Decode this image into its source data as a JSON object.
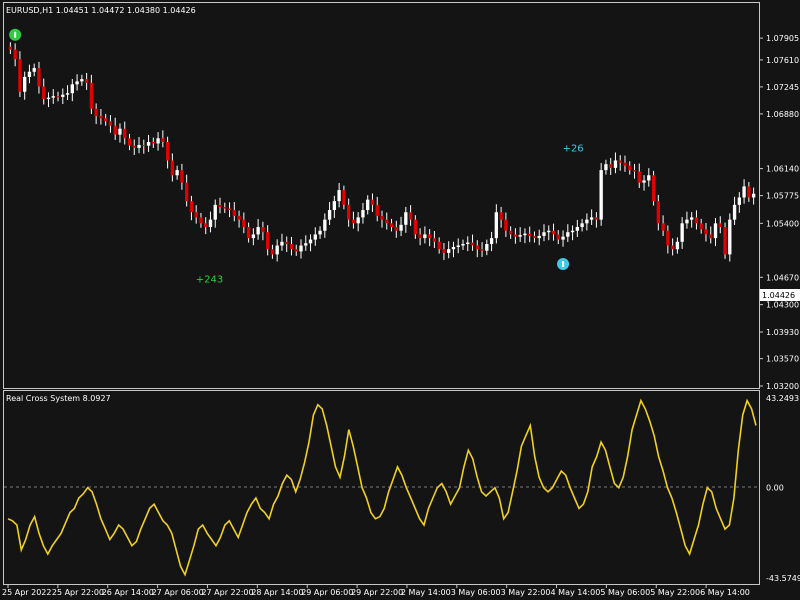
{
  "colors": {
    "background": "#141414",
    "frame": "#c8c8c8",
    "grid_zero": "#7a7a7a",
    "bull": "#ffffff",
    "bear": "#e00000",
    "wick": "#ffffff",
    "indicator": "#f0d020",
    "signal_buy": "#2ecc40",
    "signal_sell": "#40c8e8",
    "price_tag_bg": "#ffffff",
    "price_tag_fg": "#000000"
  },
  "chart_data": [
    {
      "type": "candlestick",
      "title": "EURUSD,H1 1.04451 1.04472 1.04380 1.04426",
      "y_ticks": [
        "1.07905",
        "1.07610",
        "1.07245",
        "1.06880",
        "1.06140",
        "1.05775",
        "1.05400",
        "1.04670",
        "1.04300",
        "1.03930",
        "1.03570",
        "1.03200"
      ],
      "ylim": [
        1.032,
        1.0815
      ],
      "current_price": "1.04426",
      "x_labels": [
        "25 Apr 2022",
        "25 Apr 22:00",
        "26 Apr 14:00",
        "27 Apr 06:00",
        "27 Apr 22:00",
        "28 Apr 14:00",
        "29 Apr 06:00",
        "29 Apr 22:00",
        "2 May 14:00",
        "3 May 06:00",
        "3 May 22:00",
        "4 May 14:00",
        "5 May 06:00",
        "5 May 22:00",
        "6 May 14:00"
      ],
      "close": [
        1.0775,
        1.0762,
        1.0718,
        1.0738,
        1.0745,
        1.075,
        1.0725,
        1.0708,
        1.071,
        1.0712,
        1.0711,
        1.0714,
        1.0716,
        1.0728,
        1.0732,
        1.0735,
        1.073,
        1.0695,
        1.0685,
        1.0682,
        1.0678,
        1.0672,
        1.066,
        1.0668,
        1.0655,
        1.0645,
        1.0642,
        1.0646,
        1.0645,
        1.065,
        1.0648,
        1.0655,
        1.065,
        1.0625,
        1.0605,
        1.0612,
        1.0595,
        1.057,
        1.0555,
        1.0548,
        1.054,
        1.0535,
        1.0545,
        1.0565,
        1.0562,
        1.056,
        1.0558,
        1.055,
        1.0545,
        1.0535,
        1.052,
        1.0525,
        1.0535,
        1.0528,
        1.0505,
        1.0498,
        1.051,
        1.0515,
        1.0512,
        1.0505,
        1.0502,
        1.051,
        1.0513,
        1.0518,
        1.0525,
        1.053,
        1.0545,
        1.0558,
        1.057,
        1.0585,
        1.0565,
        1.0545,
        1.054,
        1.0548,
        1.0558,
        1.0572,
        1.0565,
        1.055,
        1.0545,
        1.054,
        1.0535,
        1.053,
        1.0538,
        1.0555,
        1.0545,
        1.0525,
        1.052,
        1.0525,
        1.052,
        1.0515,
        1.0505,
        1.05,
        1.0505,
        1.0508,
        1.051,
        1.0512,
        1.0514,
        1.051,
        1.0505,
        1.0503,
        1.0512,
        1.052,
        1.0555,
        1.0545,
        1.053,
        1.0525,
        1.0522,
        1.0524,
        1.0526,
        1.0523,
        1.052,
        1.0523,
        1.0528,
        1.053,
        1.0525,
        1.0518,
        1.0522,
        1.0528,
        1.053,
        1.0535,
        1.054,
        1.0545,
        1.0548,
        1.0545,
        1.0612,
        1.062,
        1.0615,
        1.0625,
        1.0622,
        1.0618,
        1.0612,
        1.061,
        1.0595,
        1.0598,
        1.0605,
        1.057,
        1.054,
        1.053,
        1.051,
        1.0505,
        1.0515,
        1.054,
        1.0545,
        1.0548,
        1.054,
        1.0532,
        1.0525,
        1.052,
        1.054,
        1.0535,
        1.0498,
        1.0545,
        1.0565,
        1.0575,
        1.059,
        1.0575,
        1.058
      ],
      "signals": [
        {
          "kind": "buy",
          "bar": 1,
          "price": 1.0795
        },
        {
          "kind": "buy-label",
          "text": "+243",
          "bar": 41,
          "price": 1.046
        },
        {
          "kind": "sell",
          "bar": 116,
          "price": 1.0485
        },
        {
          "kind": "sell-label",
          "text": "+26",
          "bar": 118,
          "price": 1.0637
        }
      ]
    },
    {
      "type": "line",
      "title": "Real Cross System 8.0927",
      "y_ticks": [
        "43.2493",
        "0.00",
        "-43.5749"
      ],
      "ylim": [
        -43.5749,
        43.2493
      ],
      "zero_line": "dashed",
      "values": [
        -15,
        -16,
        -18,
        -30,
        -25,
        -18,
        -14,
        -22,
        -28,
        -32,
        -28,
        -25,
        -22,
        -17,
        -12,
        -10,
        -5,
        -3,
        0,
        -2,
        -8,
        -15,
        -20,
        -25,
        -22,
        -18,
        -20,
        -24,
        -28,
        -26,
        -20,
        -15,
        -10,
        -8,
        -12,
        -16,
        -18,
        -22,
        -30,
        -38,
        -42,
        -35,
        -28,
        -20,
        -18,
        -22,
        -25,
        -28,
        -24,
        -18,
        -16,
        -20,
        -24,
        -18,
        -12,
        -8,
        -5,
        -10,
        -12,
        -15,
        -8,
        -4,
        2,
        6,
        4,
        -2,
        4,
        12,
        22,
        35,
        40,
        38,
        30,
        20,
        10,
        5,
        15,
        28,
        20,
        10,
        0,
        -5,
        -12,
        -15,
        -14,
        -10,
        -2,
        4,
        10,
        6,
        0,
        -5,
        -10,
        -15,
        -18,
        -10,
        -5,
        0,
        2,
        -2,
        -8,
        -4,
        0,
        10,
        18,
        14,
        5,
        -2,
        -4,
        -2,
        0,
        -5,
        -15,
        -12,
        -2,
        8,
        20,
        25,
        30,
        15,
        5,
        0,
        -2,
        0,
        4,
        8,
        6,
        0,
        -5,
        -10,
        -8,
        -2,
        10,
        15,
        22,
        18,
        10,
        2,
        0,
        5,
        15,
        28,
        35,
        42,
        38,
        32,
        25,
        15,
        8,
        0,
        -5,
        -12,
        -20,
        -28,
        -32,
        -25,
        -18,
        -8,
        0,
        -2,
        -10,
        -15,
        -20,
        -18,
        -5,
        18,
        35,
        42,
        38,
        30
      ]
    }
  ]
}
